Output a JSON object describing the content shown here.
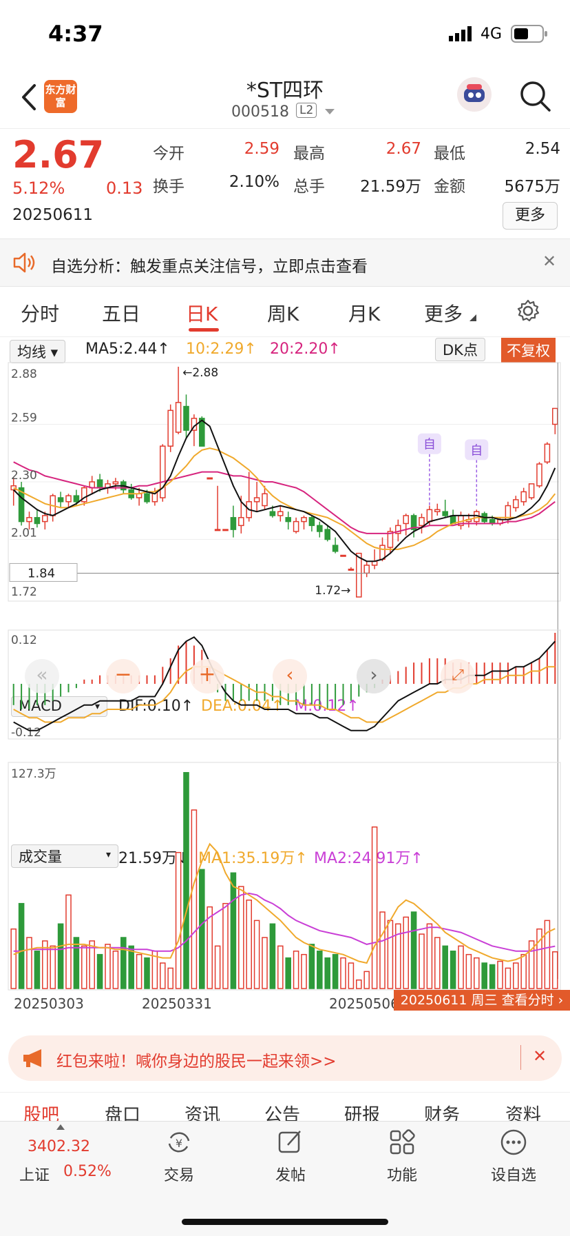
{
  "status_bar": {
    "time": "4:37",
    "network": "4G"
  },
  "header": {
    "logo_text": "东方财富",
    "name": "*ST四环",
    "code": "000518",
    "level": "L2"
  },
  "quote": {
    "price": "2.67",
    "change_pct": "5.12%",
    "change": "0.13",
    "date": "20250611",
    "open_label": "今开",
    "open": "2.59",
    "high_label": "最高",
    "high": "2.67",
    "low_label": "最低",
    "low": "2.54",
    "turnover_label": "换手",
    "turnover": "2.10%",
    "volume_label": "总手",
    "volume": "21.59万",
    "amount_label": "金额",
    "amount": "5675万",
    "more_label": "更多"
  },
  "alert": {
    "text": "自选分析：触发重点关注信号，立即点击查看"
  },
  "tabs": [
    "分时",
    "五日",
    "日K",
    "周K",
    "月K",
    "更多"
  ],
  "active_tab": "日K",
  "kline_legend": {
    "selector": "均线",
    "ma5": "MA5:2.44↑",
    "ma10": "10:2.29↑",
    "ma20": "20:2.20↑",
    "dk_label": "DK点",
    "adjust_label": "不复权",
    "ma5_color": "#111111",
    "ma10_color": "#f0a92c",
    "ma20_color": "#d6247e",
    "max_label": "←2.88",
    "min_label": "1.72→",
    "crosshair_price": "1.84",
    "tick_labels": [
      "2.88",
      "2.59",
      "2.30",
      "2.01",
      "1.72"
    ],
    "marker_text": "自"
  },
  "macd_legend": {
    "selector": "MACD",
    "dif": "DIF:0.10↑",
    "dea": "DEA:0.04↑",
    "m": "M:0.12↑",
    "top_tick": "0.12",
    "bottom_tick": "-0.12"
  },
  "vol_legend": {
    "selector": "成交量",
    "vol": "21.59万↓",
    "ma1": "MA1:35.19万↑",
    "ma2": "MA2:24.91万↑",
    "top_tick": "127.3万"
  },
  "dates": [
    "20250303",
    "20250331",
    "20250506"
  ],
  "date_tooltip": "20250611 周三 查看分时",
  "promo": {
    "text": "红包来啦！喊你身边的股民一起来领>>"
  },
  "sub_tabs": [
    "股吧",
    "盘口",
    "资讯",
    "公告",
    "研报",
    "财务",
    "资料"
  ],
  "bottom_bar": {
    "index_value": "3402.32",
    "index_name": "上证",
    "index_change": "0.52%",
    "items": [
      "交易",
      "发帖",
      "功能",
      "设自选"
    ]
  },
  "chart_data": [
    {
      "type": "candlestick",
      "title": "日K",
      "ylim": [
        1.72,
        2.88
      ],
      "ohlc": [
        [
          2.26,
          2.32,
          2.18,
          2.28
        ],
        [
          2.27,
          2.3,
          2.08,
          2.1
        ],
        [
          2.1,
          2.15,
          2.06,
          2.12
        ],
        [
          2.12,
          2.16,
          2.07,
          2.09
        ],
        [
          2.1,
          2.15,
          2.06,
          2.13
        ],
        [
          2.13,
          2.24,
          2.1,
          2.23
        ],
        [
          2.22,
          2.25,
          2.17,
          2.2
        ],
        [
          2.2,
          2.24,
          2.17,
          2.23
        ],
        [
          2.23,
          2.26,
          2.18,
          2.2
        ],
        [
          2.2,
          2.28,
          2.18,
          2.27
        ],
        [
          2.27,
          2.33,
          2.24,
          2.3
        ],
        [
          2.31,
          2.34,
          2.25,
          2.27
        ],
        [
          2.27,
          2.31,
          2.24,
          2.29
        ],
        [
          2.29,
          2.32,
          2.26,
          2.3
        ],
        [
          2.3,
          2.31,
          2.24,
          2.26
        ],
        [
          2.26,
          2.29,
          2.21,
          2.22
        ],
        [
          2.22,
          2.27,
          2.18,
          2.24
        ],
        [
          2.24,
          2.26,
          2.19,
          2.2
        ],
        [
          2.2,
          2.27,
          2.18,
          2.25
        ],
        [
          2.22,
          2.49,
          2.2,
          2.48
        ],
        [
          2.48,
          2.69,
          2.45,
          2.66
        ],
        [
          2.55,
          2.88,
          2.54,
          2.7
        ],
        [
          2.68,
          2.74,
          2.52,
          2.56
        ],
        [
          2.56,
          2.64,
          2.48,
          2.62
        ],
        [
          2.62,
          2.63,
          2.48,
          2.48
        ],
        [
          2.32,
          2.32,
          2.32,
          2.32
        ],
        [
          2.06,
          2.28,
          2.06,
          2.06
        ],
        [
          2.06,
          2.06,
          2.06,
          2.06
        ],
        [
          2.12,
          2.18,
          2.02,
          2.06
        ],
        [
          2.08,
          2.23,
          2.04,
          2.12
        ],
        [
          2.12,
          2.35,
          2.1,
          2.2
        ],
        [
          2.2,
          2.3,
          2.15,
          2.22
        ],
        [
          2.18,
          2.28,
          2.16,
          2.24
        ],
        [
          2.15,
          2.18,
          2.12,
          2.13
        ],
        [
          2.13,
          2.18,
          2.1,
          2.15
        ],
        [
          2.12,
          2.15,
          2.06,
          2.1
        ],
        [
          2.05,
          2.12,
          2.04,
          2.1
        ],
        [
          2.1,
          2.13,
          2.06,
          2.12
        ],
        [
          2.12,
          2.13,
          2.05,
          2.08
        ],
        [
          2.08,
          2.1,
          2.02,
          2.05
        ],
        [
          2.06,
          2.08,
          2.0,
          2.01
        ],
        [
          1.98,
          2.02,
          1.94,
          1.95
        ],
        [
          1.93,
          1.93,
          1.93,
          1.93
        ],
        [
          1.86,
          1.87,
          1.86,
          1.86
        ],
        [
          1.72,
          1.94,
          1.72,
          1.94
        ],
        [
          1.84,
          1.9,
          1.82,
          1.88
        ],
        [
          1.88,
          1.96,
          1.86,
          1.9
        ],
        [
          1.91,
          2.02,
          1.9,
          1.98
        ],
        [
          1.97,
          2.07,
          1.94,
          2.05
        ],
        [
          2.04,
          2.11,
          2.0,
          2.08
        ],
        [
          2.09,
          2.14,
          2.03,
          2.13
        ],
        [
          2.13,
          2.14,
          2.02,
          2.06
        ],
        [
          2.08,
          2.14,
          2.04,
          2.12
        ],
        [
          2.1,
          2.18,
          2.08,
          2.16
        ],
        [
          2.15,
          2.19,
          2.13,
          2.16
        ],
        [
          2.15,
          2.21,
          2.12,
          2.13
        ],
        [
          2.13,
          2.16,
          2.09,
          2.09
        ],
        [
          2.08,
          2.15,
          2.06,
          2.13
        ],
        [
          2.1,
          2.14,
          2.07,
          2.11
        ],
        [
          2.1,
          2.16,
          2.08,
          2.15
        ],
        [
          2.14,
          2.15,
          2.09,
          2.1
        ],
        [
          2.11,
          2.13,
          2.08,
          2.09
        ],
        [
          2.09,
          2.12,
          2.08,
          2.11
        ],
        [
          2.11,
          2.2,
          2.09,
          2.18
        ],
        [
          2.17,
          2.23,
          2.15,
          2.21
        ],
        [
          2.2,
          2.27,
          2.18,
          2.25
        ],
        [
          2.22,
          2.29,
          2.21,
          2.29
        ],
        [
          2.28,
          2.4,
          2.27,
          2.39
        ],
        [
          2.4,
          2.5,
          2.39,
          2.49
        ],
        [
          2.59,
          2.67,
          2.54,
          2.67
        ]
      ],
      "ma5": [
        2.26,
        2.22,
        2.19,
        2.16,
        2.14,
        2.13,
        2.15,
        2.17,
        2.19,
        2.22,
        2.24,
        2.26,
        2.27,
        2.28,
        2.28,
        2.27,
        2.26,
        2.25,
        2.24,
        2.27,
        2.33,
        2.43,
        2.52,
        2.58,
        2.61,
        2.58,
        2.48,
        2.38,
        2.28,
        2.2,
        2.16,
        2.15,
        2.16,
        2.17,
        2.18,
        2.17,
        2.16,
        2.15,
        2.13,
        2.11,
        2.08,
        2.05,
        2.0,
        1.95,
        1.92,
        1.9,
        1.9,
        1.91,
        1.94,
        1.98,
        2.02,
        2.05,
        2.07,
        2.1,
        2.11,
        2.12,
        2.13,
        2.13,
        2.13,
        2.13,
        2.12,
        2.12,
        2.11,
        2.11,
        2.12,
        2.14,
        2.17,
        2.21,
        2.28,
        2.37
      ],
      "ma10": [
        2.27,
        2.25,
        2.23,
        2.21,
        2.19,
        2.18,
        2.17,
        2.17,
        2.18,
        2.19,
        2.2,
        2.21,
        2.22,
        2.23,
        2.24,
        2.24,
        2.24,
        2.25,
        2.25,
        2.27,
        2.3,
        2.34,
        2.38,
        2.43,
        2.46,
        2.47,
        2.46,
        2.44,
        2.42,
        2.39,
        2.36,
        2.32,
        2.27,
        2.23,
        2.2,
        2.18,
        2.16,
        2.15,
        2.14,
        2.13,
        2.12,
        2.1,
        2.08,
        2.05,
        2.02,
        1.99,
        1.97,
        1.96,
        1.96,
        1.96,
        1.97,
        1.98,
        2.0,
        2.02,
        2.05,
        2.07,
        2.09,
        2.1,
        2.11,
        2.12,
        2.12,
        2.12,
        2.12,
        2.12,
        2.12,
        2.13,
        2.14,
        2.16,
        2.19,
        2.24
      ],
      "ma20": [
        2.4,
        2.38,
        2.36,
        2.35,
        2.33,
        2.32,
        2.31,
        2.3,
        2.29,
        2.28,
        2.27,
        2.27,
        2.27,
        2.27,
        2.27,
        2.27,
        2.28,
        2.28,
        2.29,
        2.3,
        2.31,
        2.32,
        2.33,
        2.34,
        2.35,
        2.35,
        2.35,
        2.34,
        2.33,
        2.33,
        2.32,
        2.31,
        2.3,
        2.3,
        2.29,
        2.28,
        2.27,
        2.25,
        2.22,
        2.19,
        2.16,
        2.13,
        2.1,
        2.07,
        2.05,
        2.04,
        2.04,
        2.04,
        2.04,
        2.05,
        2.06,
        2.07,
        2.07,
        2.08,
        2.08,
        2.08,
        2.08,
        2.09,
        2.09,
        2.09,
        2.09,
        2.09,
        2.09,
        2.1,
        2.1,
        2.11,
        2.12,
        2.14,
        2.17,
        2.2
      ]
    },
    {
      "type": "bar",
      "title": "MACD",
      "ylim": [
        -0.12,
        0.12
      ],
      "values": [
        -0.05,
        -0.06,
        -0.06,
        -0.05,
        -0.05,
        -0.04,
        -0.03,
        -0.02,
        -0.01,
        0.01,
        0.01,
        0.02,
        0.02,
        0.02,
        0.02,
        0.02,
        0.02,
        0.02,
        0.02,
        0.04,
        0.06,
        0.09,
        0.1,
        0.09,
        0.08,
        0.04,
        -0.02,
        -0.04,
        -0.04,
        -0.04,
        -0.04,
        -0.04,
        -0.04,
        -0.04,
        -0.05,
        -0.05,
        -0.05,
        -0.05,
        -0.05,
        -0.06,
        -0.06,
        -0.06,
        -0.05,
        -0.04,
        -0.03,
        -0.02,
        -0.01,
        0.01,
        0.02,
        0.03,
        0.04,
        0.05,
        0.05,
        0.06,
        0.06,
        0.06,
        0.05,
        0.05,
        0.05,
        0.05,
        0.05,
        0.05,
        0.05,
        0.05,
        0.04,
        0.04,
        0.05,
        0.06,
        0.08,
        0.12
      ],
      "dif": [
        -0.09,
        -0.1,
        -0.11,
        -0.11,
        -0.1,
        -0.09,
        -0.08,
        -0.07,
        -0.06,
        -0.05,
        -0.05,
        -0.04,
        -0.04,
        -0.04,
        -0.04,
        -0.04,
        -0.03,
        -0.03,
        -0.03,
        0.0,
        0.04,
        0.08,
        0.1,
        0.11,
        0.09,
        0.05,
        0.01,
        -0.02,
        -0.04,
        -0.05,
        -0.05,
        -0.05,
        -0.06,
        -0.06,
        -0.06,
        -0.06,
        -0.07,
        -0.07,
        -0.07,
        -0.08,
        -0.08,
        -0.09,
        -0.1,
        -0.11,
        -0.11,
        -0.11,
        -0.1,
        -0.08,
        -0.06,
        -0.04,
        -0.03,
        -0.02,
        -0.01,
        0.0,
        0.0,
        0.01,
        0.01,
        0.01,
        0.02,
        0.02,
        0.02,
        0.03,
        0.03,
        0.03,
        0.04,
        0.04,
        0.05,
        0.06,
        0.08,
        0.1
      ],
      "dea": [
        -0.06,
        -0.07,
        -0.08,
        -0.08,
        -0.09,
        -0.09,
        -0.09,
        -0.08,
        -0.08,
        -0.08,
        -0.07,
        -0.07,
        -0.06,
        -0.06,
        -0.06,
        -0.06,
        -0.05,
        -0.05,
        -0.05,
        -0.04,
        -0.02,
        0.01,
        0.03,
        0.04,
        0.04,
        0.04,
        0.03,
        0.02,
        0.01,
        0.0,
        -0.01,
        -0.02,
        -0.02,
        -0.03,
        -0.03,
        -0.04,
        -0.04,
        -0.05,
        -0.05,
        -0.05,
        -0.06,
        -0.06,
        -0.07,
        -0.08,
        -0.08,
        -0.09,
        -0.09,
        -0.09,
        -0.08,
        -0.07,
        -0.06,
        -0.05,
        -0.04,
        -0.03,
        -0.02,
        -0.02,
        -0.01,
        -0.01,
        0.0,
        0.0,
        0.01,
        0.01,
        0.01,
        0.02,
        0.02,
        0.02,
        0.03,
        0.03,
        0.04,
        0.04
      ]
    },
    {
      "type": "bar",
      "title": "成交量",
      "ylim": [
        0,
        127.3
      ],
      "values": [
        35,
        50,
        30,
        22,
        28,
        25,
        38,
        55,
        30,
        25,
        28,
        20,
        26,
        22,
        30,
        25,
        20,
        18,
        22,
        15,
        12,
        80,
        127,
        105,
        70,
        48,
        25,
        50,
        68,
        60,
        52,
        40,
        30,
        38,
        25,
        18,
        22,
        20,
        26,
        22,
        18,
        20,
        18,
        15,
        5,
        10,
        95,
        45,
        40,
        38,
        42,
        45,
        32,
        38,
        30,
        25,
        22,
        25,
        20,
        18,
        15,
        14,
        16,
        12,
        15,
        20,
        28,
        35,
        40,
        21.59
      ],
      "ma1": [
        20,
        22,
        23,
        24,
        24,
        24,
        25,
        26,
        26,
        26,
        25,
        24,
        24,
        23,
        23,
        22,
        21,
        20,
        19,
        18,
        18,
        28,
        45,
        62,
        75,
        85,
        80,
        68,
        60,
        58,
        55,
        52,
        48,
        44,
        40,
        35,
        30,
        27,
        25,
        23,
        22,
        21,
        20,
        18,
        16,
        15,
        25,
        32,
        40,
        48,
        52,
        50,
        46,
        42,
        38,
        33,
        30,
        27,
        24,
        22,
        20,
        18,
        17,
        16,
        17,
        19,
        23,
        28,
        33,
        35.19
      ],
      "ma2": [
        22,
        22,
        23,
        23,
        23,
        23,
        23,
        24,
        24,
        24,
        24,
        24,
        24,
        24,
        24,
        23,
        23,
        23,
        22,
        22,
        22,
        24,
        28,
        33,
        38,
        42,
        45,
        48,
        52,
        55,
        56,
        55,
        52,
        50,
        47,
        43,
        40,
        38,
        36,
        34,
        33,
        32,
        31,
        30,
        28,
        26,
        27,
        28,
        30,
        32,
        33,
        34,
        35,
        36,
        36,
        35,
        34,
        33,
        31,
        29,
        27,
        25,
        24,
        23,
        22,
        22,
        22,
        23,
        24,
        24.91
      ]
    }
  ]
}
